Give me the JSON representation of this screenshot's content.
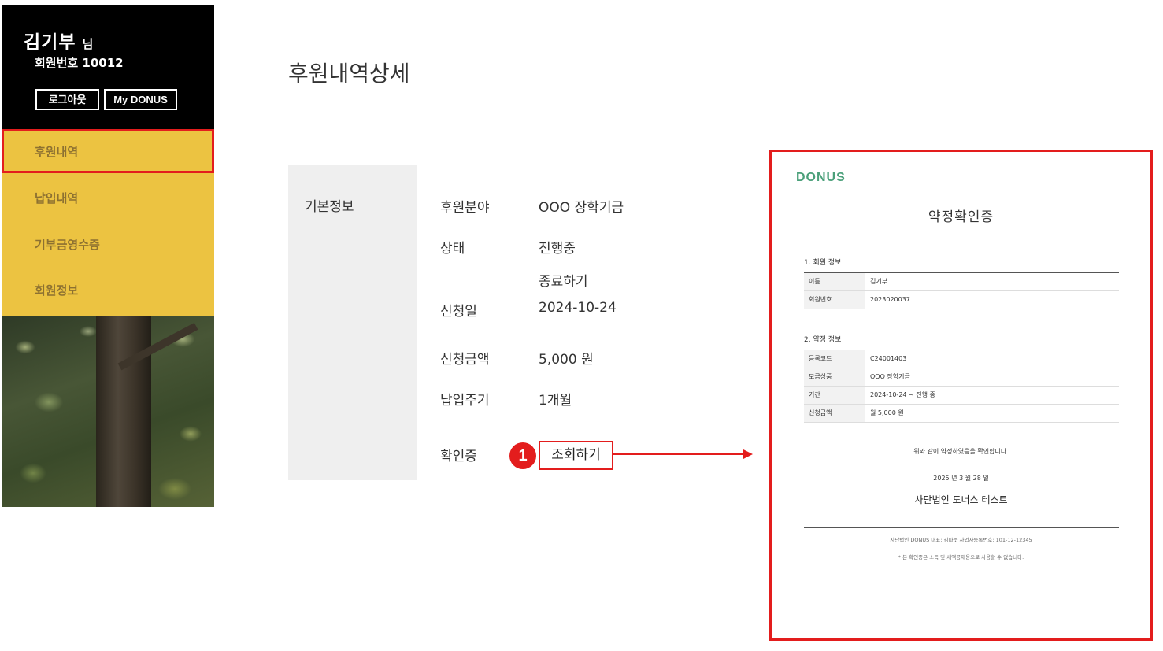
{
  "sidebar": {
    "user_name": "김기부",
    "user_suffix": "님",
    "member_label": "회원번호 10012",
    "logout_label": "로그아웃",
    "mydonus_label": "My DONUS",
    "menu": [
      {
        "label": "후원내역",
        "active": true
      },
      {
        "label": "납입내역",
        "active": false
      },
      {
        "label": "기부금영수증",
        "active": false
      },
      {
        "label": "회원정보",
        "active": false
      }
    ]
  },
  "main": {
    "title": "후원내역상세",
    "section_label": "기본정보",
    "fields": [
      {
        "label": "후원분야",
        "value": "OOO 장학기금"
      },
      {
        "label": "상태",
        "value": "진행중"
      },
      {
        "label": "신청일",
        "value": "2024-10-24"
      },
      {
        "label": "신청금액",
        "value": "5,000 원"
      },
      {
        "label": "납입주기",
        "value": "1개월"
      },
      {
        "label": "확인증",
        "value": ""
      }
    ],
    "end_link": "종료하기",
    "view_button": "조회하기",
    "step_badge": "1"
  },
  "certificate": {
    "brand": "DONUS",
    "title": "약정확인증",
    "section1_title": "1. 회원 정보",
    "section1_rows": [
      {
        "key": "이름",
        "value": "김기부"
      },
      {
        "key": "회원번호",
        "value": "2023020037"
      }
    ],
    "section2_title": "2. 약정 정보",
    "section2_rows": [
      {
        "key": "등록코드",
        "value": "C24001403"
      },
      {
        "key": "모금상품",
        "value": "OOO 장학기금"
      },
      {
        "key": "기간",
        "value": "2024-10-24 ~ 진행 중"
      },
      {
        "key": "신청금액",
        "value": "월 5,000 원"
      }
    ],
    "confirm_text": "위와 같이 약정하였음을 확인합니다.",
    "date_text": "2025 년   3 월   28 일",
    "org_name": "사단법인 도너스 테스트",
    "footer_line1": "사단법인 DONUS 대표: 김따뜻 사업자등록번호: 101-12-12345",
    "footer_line2": "* 본 확인증은 소득 및 세액공제용으로 사용할 수 없습니다."
  },
  "colors": {
    "highlight_red": "#e31d1d",
    "menu_yellow": "#ecc341",
    "brand_green": "#4ba07a"
  }
}
